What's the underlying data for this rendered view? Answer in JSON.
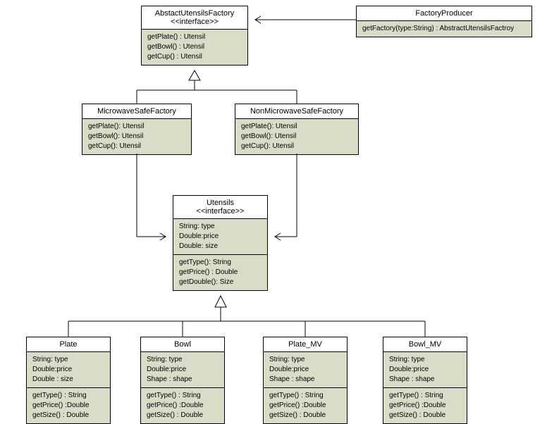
{
  "classes": {
    "abstractFactory": {
      "name": "AbstactUtensilsFactory",
      "stereotype": "<<interface>>",
      "methods": [
        "getPlate() : Utensil",
        "getBowl() : Utensil",
        "getCup()  : Utensil"
      ]
    },
    "factoryProducer": {
      "name": "FactoryProducer",
      "methods": [
        "getFactory(type:String) : AbstractUtensilsFactroy"
      ]
    },
    "microwaveFactory": {
      "name": "MicrowaveSafeFactory",
      "methods": [
        "getPlate(): Utensil",
        "getBowl(): Utensil",
        "getCup(): Utensil"
      ]
    },
    "nonMicrowaveFactory": {
      "name": "NonMicrowaveSafeFactory",
      "methods": [
        "getPlate(): Utensil",
        "getBowl(): Utensil",
        "getCup(): Utensil"
      ]
    },
    "utensils": {
      "name": "Utensils",
      "stereotype": "<<interface>>",
      "attrs": [
        "String: type",
        "Double:price",
        "Double: size"
      ],
      "methods": [
        "getType(): String",
        "getPrice() : Double",
        "getDouble(): Size"
      ]
    },
    "plate": {
      "name": "Plate",
      "attrs": [
        "String: type",
        "Double:price",
        "Double : size"
      ],
      "methods": [
        "getType() : String",
        "getPrice() :Double",
        "getSize() : Double"
      ]
    },
    "bowl": {
      "name": "Bowl",
      "attrs": [
        "String: type",
        "Double:price",
        "Shape : shape"
      ],
      "methods": [
        "getType() : String",
        "getPrice() :Double",
        "getSize() : Double"
      ]
    },
    "plateMV": {
      "name": "Plate_MV",
      "attrs": [
        "String: type",
        "Double:price",
        "Shape : shape"
      ],
      "methods": [
        "getType() : String",
        "getPrice() :Double",
        "getSize() : Double"
      ]
    },
    "bowlMV": {
      "name": "Bowl_MV",
      "attrs": [
        "String: type",
        "Double:price",
        "Shape : shape"
      ],
      "methods": [
        "getType() : String",
        "getPrice() :Double",
        "getSize() : Double"
      ]
    }
  }
}
